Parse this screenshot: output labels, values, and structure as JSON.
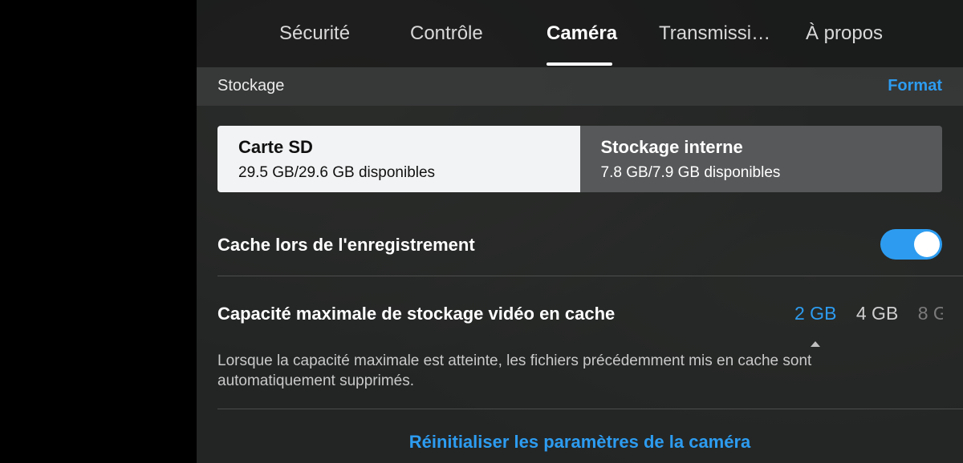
{
  "tabs": [
    {
      "label": "Sécurité"
    },
    {
      "label": "Contrôle"
    },
    {
      "label": "Caméra",
      "active": true
    },
    {
      "label": "Transmissi…"
    },
    {
      "label": "À propos"
    }
  ],
  "storage_section": {
    "title": "Stockage",
    "format_label": "Format",
    "options": [
      {
        "title": "Carte SD",
        "subtitle": "29.5 GB/29.6 GB disponibles",
        "selected": true
      },
      {
        "title": "Stockage interne",
        "subtitle": "7.8 GB/7.9 GB disponibles",
        "selected": false
      }
    ]
  },
  "cache": {
    "label": "Cache lors de l'enregistrement",
    "enabled": true
  },
  "capacity": {
    "label": "Capacité maximale de stockage vidéo en cache",
    "options": [
      "2 GB",
      "4 GB",
      "8 G"
    ],
    "selected": "2 GB",
    "description": "Lorsque la capacité maximale est atteinte, les fichiers précédemment mis en cache sont automatiquement supprimés."
  },
  "reset_label": "Réinitialiser les paramètres de la caméra",
  "colors": {
    "accent": "#2d9cf0",
    "panel": "#2b2c2c",
    "selected_option_bg": "#f2f3f4",
    "unselected_option_bg": "#57585a"
  }
}
